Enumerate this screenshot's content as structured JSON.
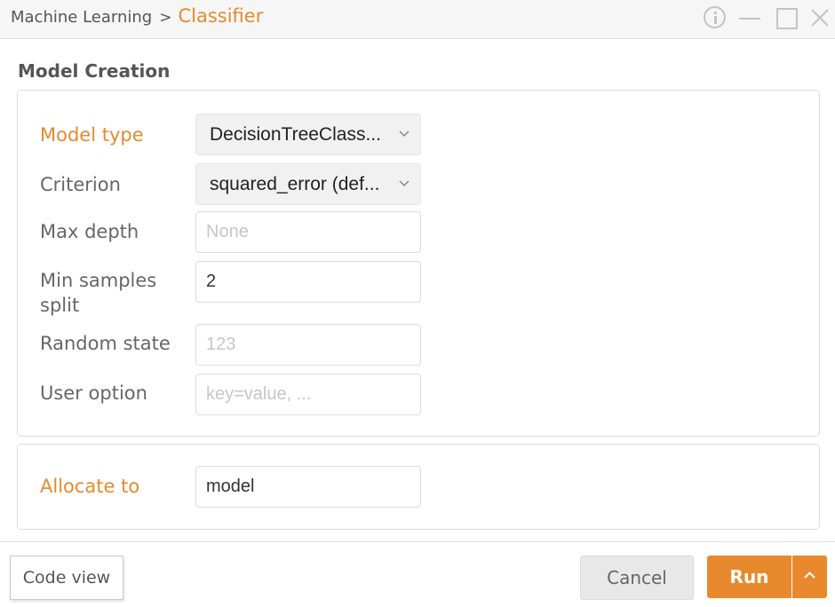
{
  "window": {
    "breadcrumb_parent": "Machine Learning",
    "breadcrumb_separator": ">",
    "breadcrumb_current": "Classifier",
    "controls": [
      "info-icon",
      "minimize-icon",
      "maximize-icon",
      "close-icon"
    ]
  },
  "section": {
    "title": "Model Creation"
  },
  "options": {
    "model_type": {
      "label": "Model type",
      "value": "DecisionTreeClass..."
    },
    "criterion": {
      "label": "Criterion",
      "value": "squared_error (def..."
    },
    "max_depth": {
      "label": "Max depth",
      "value": "",
      "placeholder": "None"
    },
    "min_samples_split": {
      "label": "Min samples split",
      "value": "2",
      "placeholder": ""
    },
    "random_state": {
      "label": "Random state",
      "value": "",
      "placeholder": "123"
    },
    "user_option": {
      "label": "User option",
      "value": "",
      "placeholder": "key=value, ..."
    }
  },
  "allocate": {
    "label": "Allocate to",
    "value": "model"
  },
  "footer": {
    "code_view_label": "Code view",
    "cancel_label": "Cancel",
    "run_label": "Run"
  },
  "colors": {
    "accent": "#e58a2e",
    "run_button": "#e8892d",
    "text": "#555555"
  }
}
